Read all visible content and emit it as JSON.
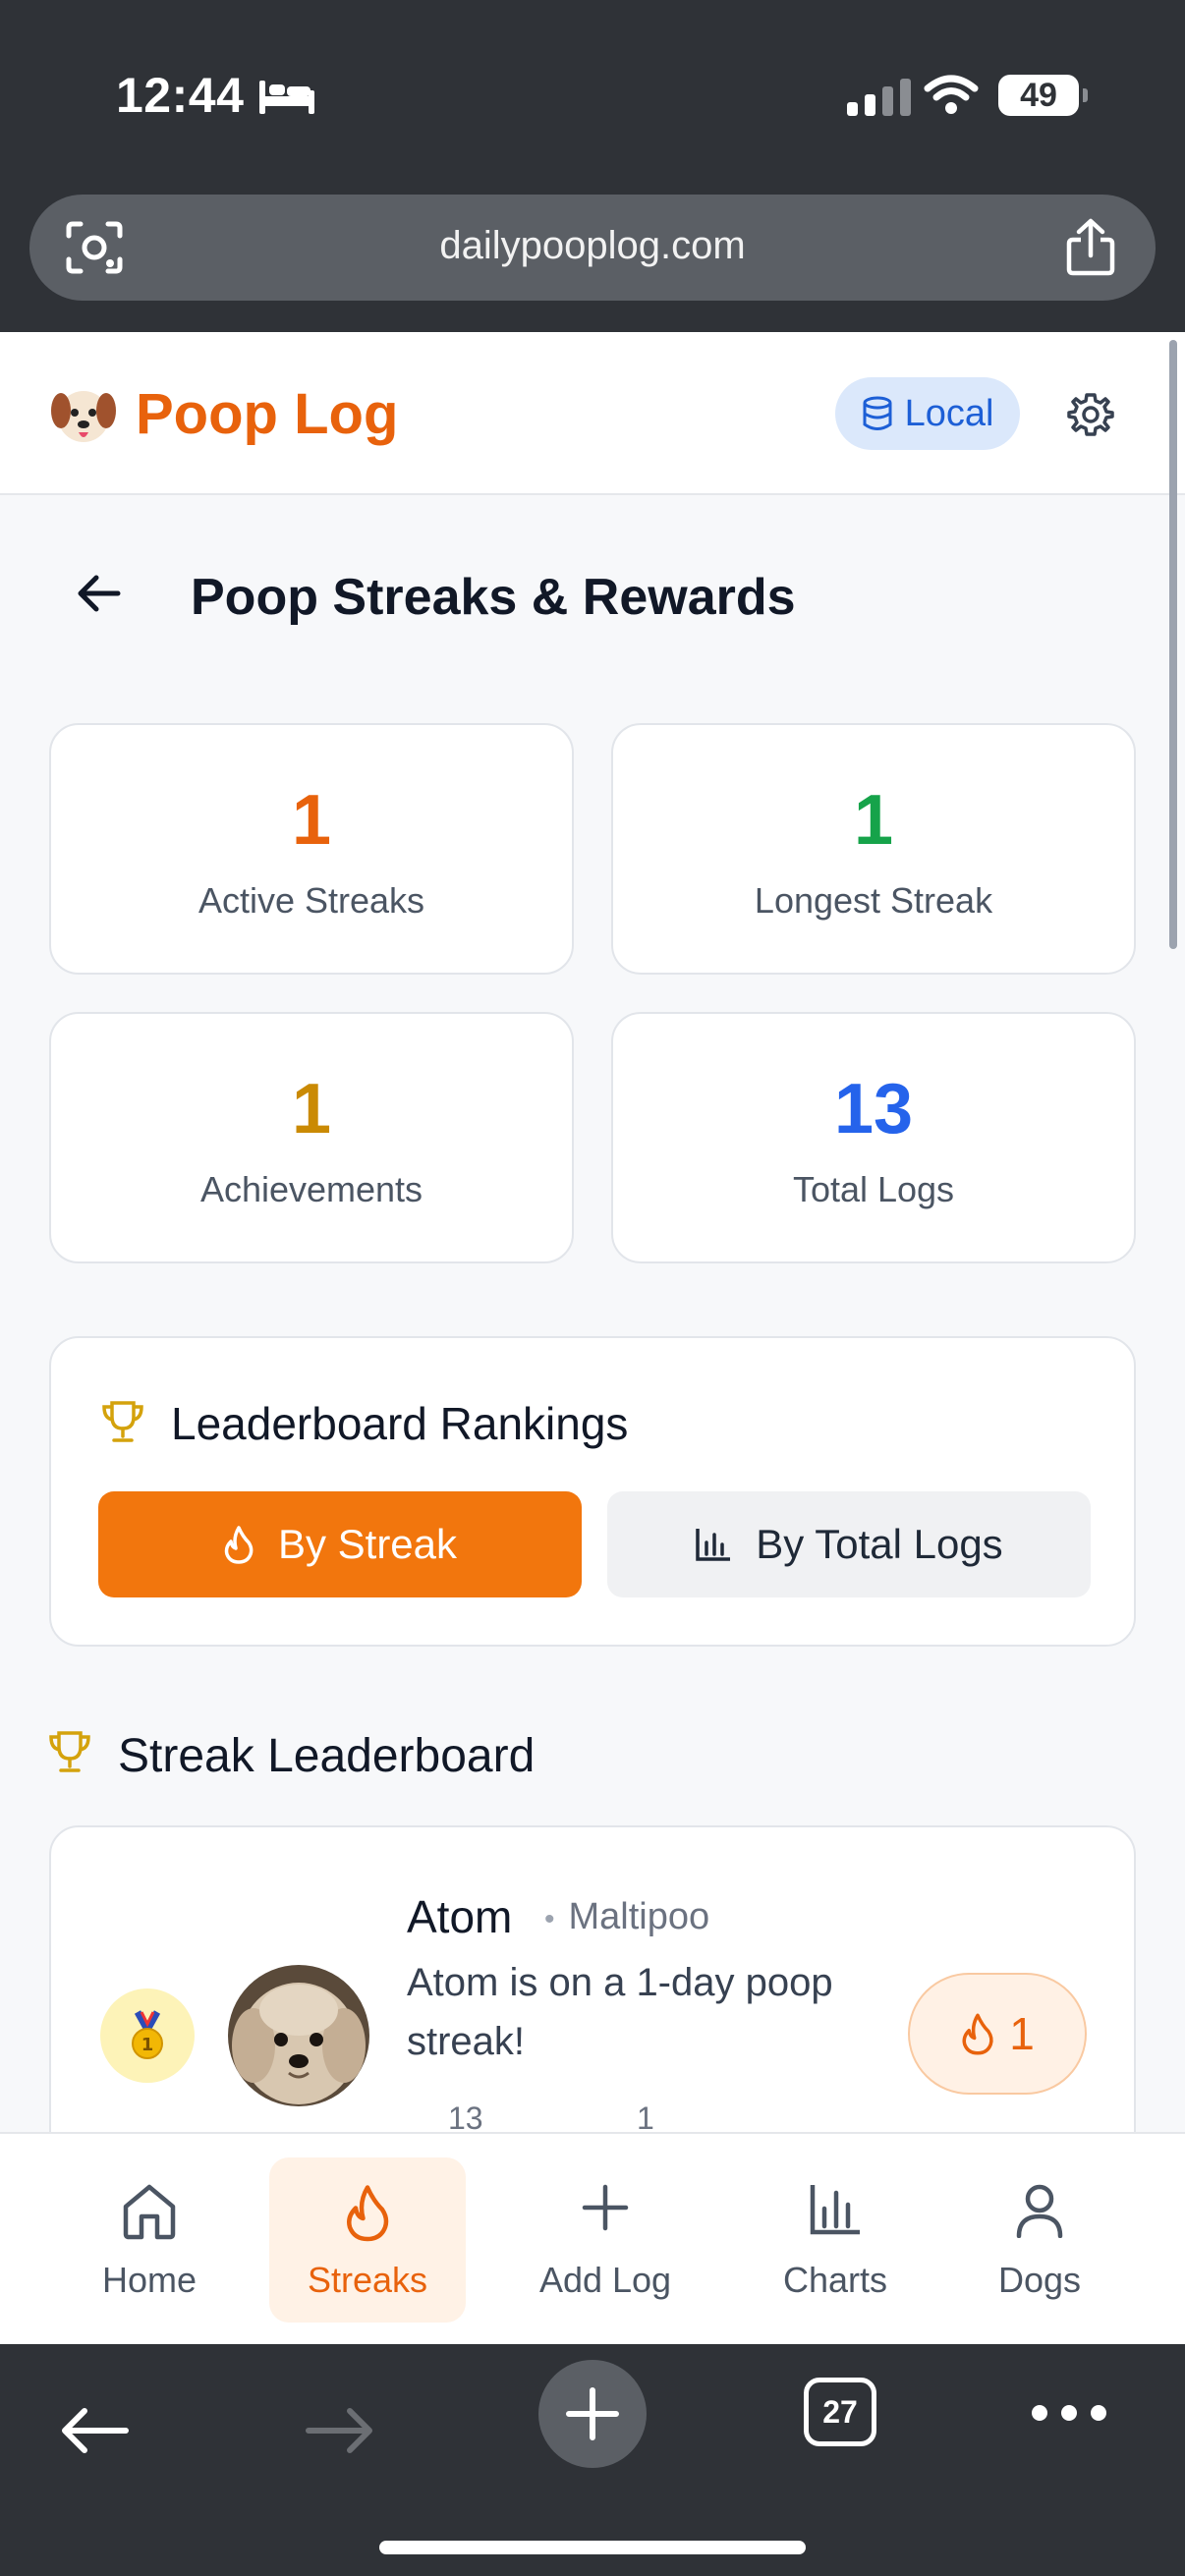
{
  "status_bar": {
    "time": "12:44",
    "battery": "49"
  },
  "browser": {
    "url": "dailypooplog.com",
    "tab_count": "27"
  },
  "app": {
    "title": "Poop Log",
    "storage_mode": "Local"
  },
  "page": {
    "title": "Poop Streaks & Rewards"
  },
  "stats": [
    {
      "value": "1",
      "label": "Active Streaks",
      "color": "#e8620c"
    },
    {
      "value": "1",
      "label": "Longest Streak",
      "color": "#16a34a"
    },
    {
      "value": "1",
      "label": "Achievements",
      "color": "#ca8a04"
    },
    {
      "value": "13",
      "label": "Total Logs",
      "color": "#2563eb"
    }
  ],
  "rankings": {
    "title": "Leaderboard Rankings",
    "by_streak_label": "By Streak",
    "by_total_label": "By Total Logs",
    "active": "By Streak"
  },
  "leaderboard": {
    "title": "Streak Leaderboard",
    "entries": [
      {
        "rank_icon": "gold-medal-icon",
        "name": "Atom",
        "breed": "Maltipoo",
        "message": "Atom is on a 1-day poop streak!",
        "mini_stat_1": "13",
        "mini_stat_2": "1",
        "streak": "1"
      }
    ]
  },
  "nav": {
    "items": [
      {
        "label": "Home",
        "icon": "home-icon"
      },
      {
        "label": "Streaks",
        "icon": "flame-icon"
      },
      {
        "label": "Add Log",
        "icon": "plus-icon"
      },
      {
        "label": "Charts",
        "icon": "bar-chart-icon"
      },
      {
        "label": "Dogs",
        "icon": "user-icon"
      }
    ],
    "active": "Streaks"
  },
  "colors": {
    "accent": "#f2760d",
    "brand": "#e8620c",
    "chrome": "#2f3237"
  }
}
